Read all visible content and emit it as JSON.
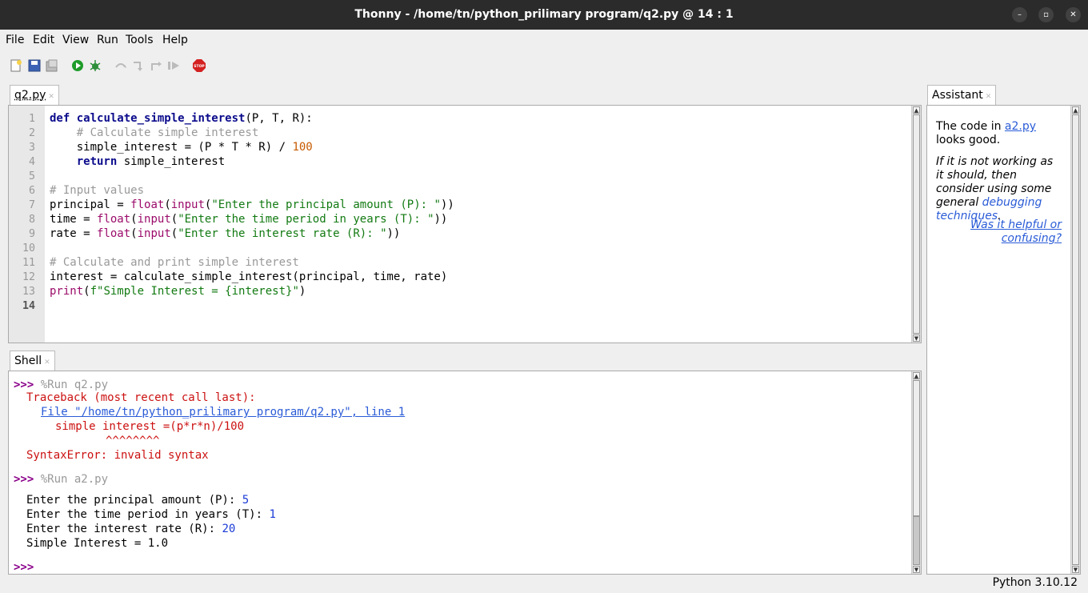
{
  "window": {
    "title": "Thonny  -  /home/tn/python_prilimary program/q2.py  @  14 : 1"
  },
  "menu": [
    "File",
    "Edit",
    "View",
    "Run",
    "Tools",
    "Help"
  ],
  "toolbar": {
    "icons": [
      "new-file-icon",
      "open-file-icon",
      "save-file-icon",
      "run-icon",
      "debug-icon",
      "step-over-icon",
      "step-into-icon",
      "step-out-icon",
      "resume-icon",
      "stop-icon"
    ],
    "stop_label": "STOP"
  },
  "editor": {
    "tab": "q2.py",
    "line_numbers": [
      "1",
      "2",
      "3",
      "4",
      "5",
      "6",
      "7",
      "8",
      "9",
      "10",
      "11",
      "12",
      "13",
      "14"
    ]
  },
  "shell": {
    "tab": "Shell",
    "prompt": ">>>",
    "run1": "%Run q2.py",
    "traceback": "Traceback (most recent call last):",
    "file_link": "File \"/home/tn/python_prilimary program/q2.py\", line 1",
    "error_code": "simple interest =(p*r*n)/100",
    "carets": "^^^^^^^^",
    "syntax_error": "SyntaxError: invalid syntax",
    "run2": "%Run a2.py",
    "output": [
      {
        "text": "Enter the principal amount (P): ",
        "input": "5"
      },
      {
        "text": "Enter the time period in years (T): ",
        "input": "1"
      },
      {
        "text": "Enter the interest rate (R): ",
        "input": "20"
      },
      {
        "text": "Simple Interest = 1.0",
        "input": ""
      }
    ]
  },
  "assistant": {
    "tab": "Assistant",
    "line1_pre": "The code in ",
    "line1_link": "a2.py",
    "line1_post": " looks good.",
    "italic_text": "If it is not working as it should, then consider using some general ",
    "italic_link": "debugging techniques",
    "italic_end": ".",
    "feedback_link": "Was it helpful or confusing?"
  },
  "status": {
    "python_version": "Python 3.10.12"
  }
}
